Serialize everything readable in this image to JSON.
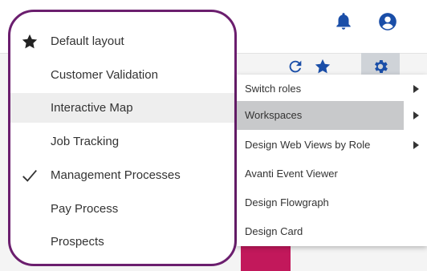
{
  "header": {
    "icons": [
      "bell-icon",
      "account-circle-icon"
    ]
  },
  "toolbar": {
    "icons": [
      "refresh-icon",
      "star-icon",
      "gear-icon"
    ]
  },
  "layout_menu": {
    "items": [
      {
        "label": "Default layout",
        "mark": "star"
      },
      {
        "label": "Customer Validation",
        "mark": ""
      },
      {
        "label": "Interactive Map",
        "mark": "",
        "highlighted": true
      },
      {
        "label": "Job Tracking",
        "mark": ""
      },
      {
        "label": "Management Processes",
        "mark": "check"
      },
      {
        "label": "Pay Process",
        "mark": ""
      },
      {
        "label": "Prospects",
        "mark": ""
      }
    ]
  },
  "settings_menu": {
    "items": [
      {
        "label": "Switch roles",
        "submenu": true
      },
      {
        "label": "Workspaces",
        "submenu": true,
        "highlighted": true
      },
      {
        "label": "Design Web Views by Role",
        "submenu": true
      },
      {
        "label": "Avanti Event Viewer",
        "submenu": false
      },
      {
        "label": "Design Flowgraph",
        "submenu": false
      },
      {
        "label": "Design Card",
        "submenu": false
      }
    ]
  },
  "colors": {
    "icon_blue": "#1a4ea8",
    "menu_border": "#6b1e6e",
    "tile_pink": "#c2185b"
  }
}
